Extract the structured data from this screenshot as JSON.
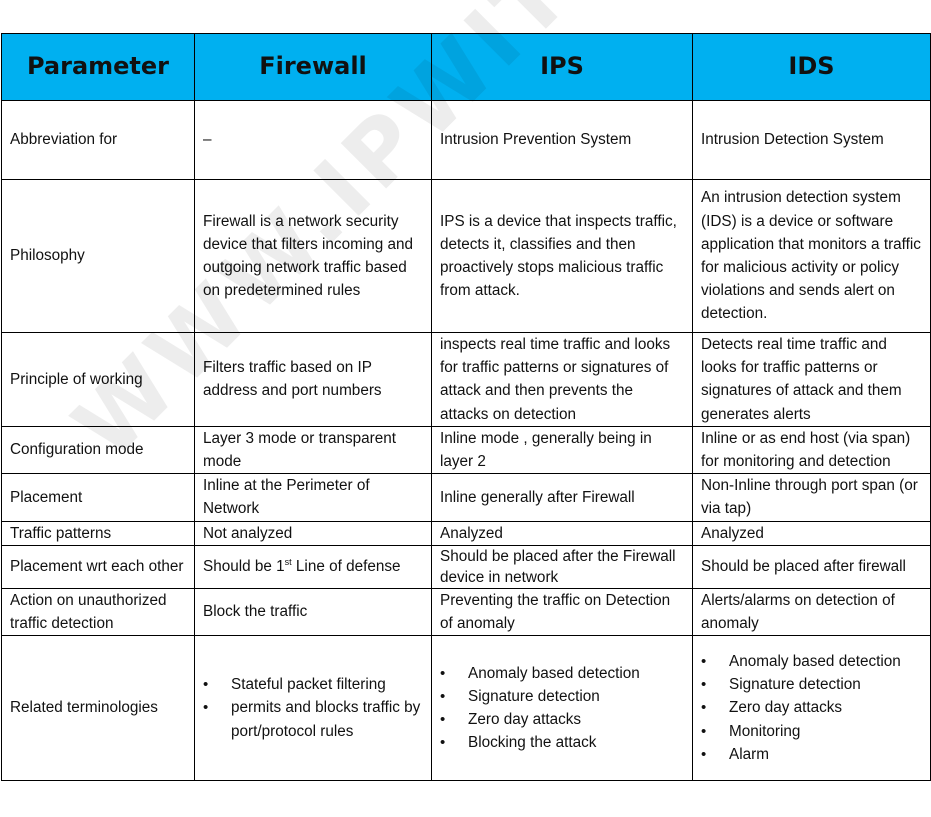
{
  "watermark": "WWW.IPWITHEASE.COM",
  "colors": {
    "header_bg": "#00b0f0",
    "border": "#000000"
  },
  "header": [
    "Parameter",
    "Firewall",
    "IPS",
    "IDS"
  ],
  "rows": [
    {
      "parameter": "Abbreviation for",
      "firewall": "–",
      "ips": "Intrusion Prevention System",
      "ids": "Intrusion Detection System"
    },
    {
      "parameter": "Philosophy",
      "firewall": "Firewall is a network security device that filters incoming and outgoing network traffic based on predetermined rules",
      "ips": "IPS is a device that inspects traffic, detects it, classifies and then proactively stops malicious traffic from attack.",
      "ids": "An intrusion detection system (IDS) is a device or software application that monitors a traffic for malicious activity or policy violations and sends alert on detection."
    },
    {
      "parameter": "Principle of working",
      "firewall": "Filters traffic based on IP address and port numbers",
      "ips": "inspects real time traffic and looks for traffic patterns or signatures of attack and then prevents the attacks on detection",
      "ids": "Detects real time traffic and looks for traffic patterns or signatures of attack and them generates alerts"
    },
    {
      "parameter": "Configuration mode",
      "firewall": "Layer 3 mode or transparent mode",
      "ips": "Inline mode , generally being in layer 2",
      "ids": "Inline or as end host (via span) for monitoring and detection"
    },
    {
      "parameter": "Placement",
      "firewall": "Inline at the Perimeter of Network",
      "ips": "Inline generally after Firewall",
      "ids": "Non-Inline through port span (or via tap)"
    },
    {
      "parameter": "Traffic patterns",
      "firewall": "Not analyzed",
      "ips": "Analyzed",
      "ids": "Analyzed"
    },
    {
      "parameter": "Placement wrt each other",
      "firewall": {
        "before": "Should be 1",
        "sup": "st",
        "after": " Line of defense"
      },
      "ips": "Should be placed after the Firewall device in network",
      "ids": "Should be placed after firewall"
    },
    {
      "parameter": "Action on unauthorized traffic detection",
      "firewall": "Block the traffic",
      "ips": "Preventing the traffic on Detection of anomaly",
      "ids": "Alerts/alarms on detection of anomaly"
    },
    {
      "parameter": "Related terminologies",
      "firewall": [
        "Stateful packet filtering",
        "permits and blocks traffic by port/protocol rules"
      ],
      "ips": [
        "Anomaly based detection",
        "Signature detection",
        "Zero day attacks",
        "Blocking the attack"
      ],
      "ids": [
        "Anomaly based detection",
        "Signature detection",
        "Zero day attacks",
        "Monitoring",
        "Alarm"
      ]
    }
  ]
}
